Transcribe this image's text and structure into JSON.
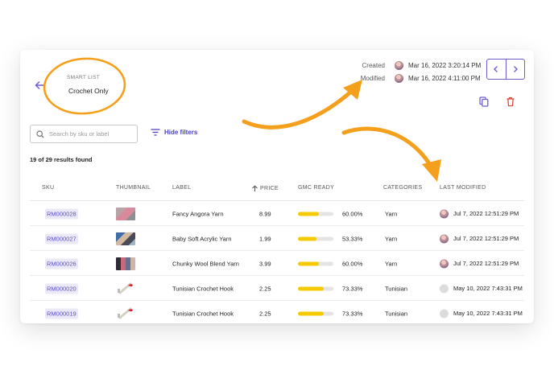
{
  "header": {
    "kicker": "SMART LIST",
    "list_name": "Crochet Only",
    "created_label": "Created",
    "created_date": "Mar 16, 2022 3:20:14 PM",
    "modified_label": "Modified",
    "modified_date": "Mar 16, 2022 4:11:00 PM"
  },
  "toolbar": {
    "search_placeholder": "Search by sku or label",
    "hide_filters_label": "Hide filters",
    "results_text": "19 of 29 results found"
  },
  "table": {
    "columns": {
      "sku": "SKU",
      "thumbnail": "THUMBNAIL",
      "label": "LABEL",
      "price": "PRICE",
      "gmc_ready": "GMC READY",
      "categories": "CATEGORIES",
      "last_modified": "LAST MODIFIED"
    },
    "rows": [
      {
        "sku": "RM000028",
        "thumb": "yarn-pink",
        "label": "Fancy Angora Yarn",
        "price": "8.99",
        "gmc": "60.00%",
        "gmc_fraction": 0.6,
        "category": "Yarn",
        "modified": "Jul 7, 2022 12:51:29 PM",
        "avatar": "photo"
      },
      {
        "sku": "RM000027",
        "thumb": "yarn-multi",
        "label": "Baby Soft Acrylic Yarn",
        "price": "1.99",
        "gmc": "53.33%",
        "gmc_fraction": 0.5333,
        "category": "Yarn",
        "modified": "Jul 7, 2022 12:51:29 PM",
        "avatar": "photo"
      },
      {
        "sku": "RM000026",
        "thumb": "yarn-chunky",
        "label": "Chunky Wool Blend Yarn",
        "price": "3.99",
        "gmc": "60.00%",
        "gmc_fraction": 0.6,
        "category": "Yarn",
        "modified": "Jul 7, 2022 12:51:29 PM",
        "avatar": "photo"
      },
      {
        "sku": "RM000020",
        "thumb": "hook",
        "label": "Tunisian Crochet Hook",
        "price": "2.25",
        "gmc": "73.33%",
        "gmc_fraction": 0.7333,
        "category": "Tunisian",
        "modified": "May 10, 2022 7:43:31 PM",
        "avatar": "blank"
      },
      {
        "sku": "RM000019",
        "thumb": "hook",
        "label": "Tunisian Crochet Hook",
        "price": "2.25",
        "gmc": "73.33%",
        "gmc_fraction": 0.7333,
        "category": "Tunisian",
        "modified": "May 10, 2022 7:43:31 PM",
        "avatar": "blank"
      }
    ]
  },
  "colors": {
    "accent": "#6b5fd0",
    "link": "#4a3fbf",
    "bar": "#f5cb00",
    "annotation": "#f5a01c",
    "delete": "#e0453a"
  },
  "icons": {
    "back": "arrow-left-icon",
    "prev": "chevron-left-icon",
    "next": "chevron-right-icon",
    "copy": "copy-icon",
    "delete": "trash-icon",
    "search": "search-icon",
    "filter": "filter-icon",
    "sort": "arrow-up-icon"
  }
}
